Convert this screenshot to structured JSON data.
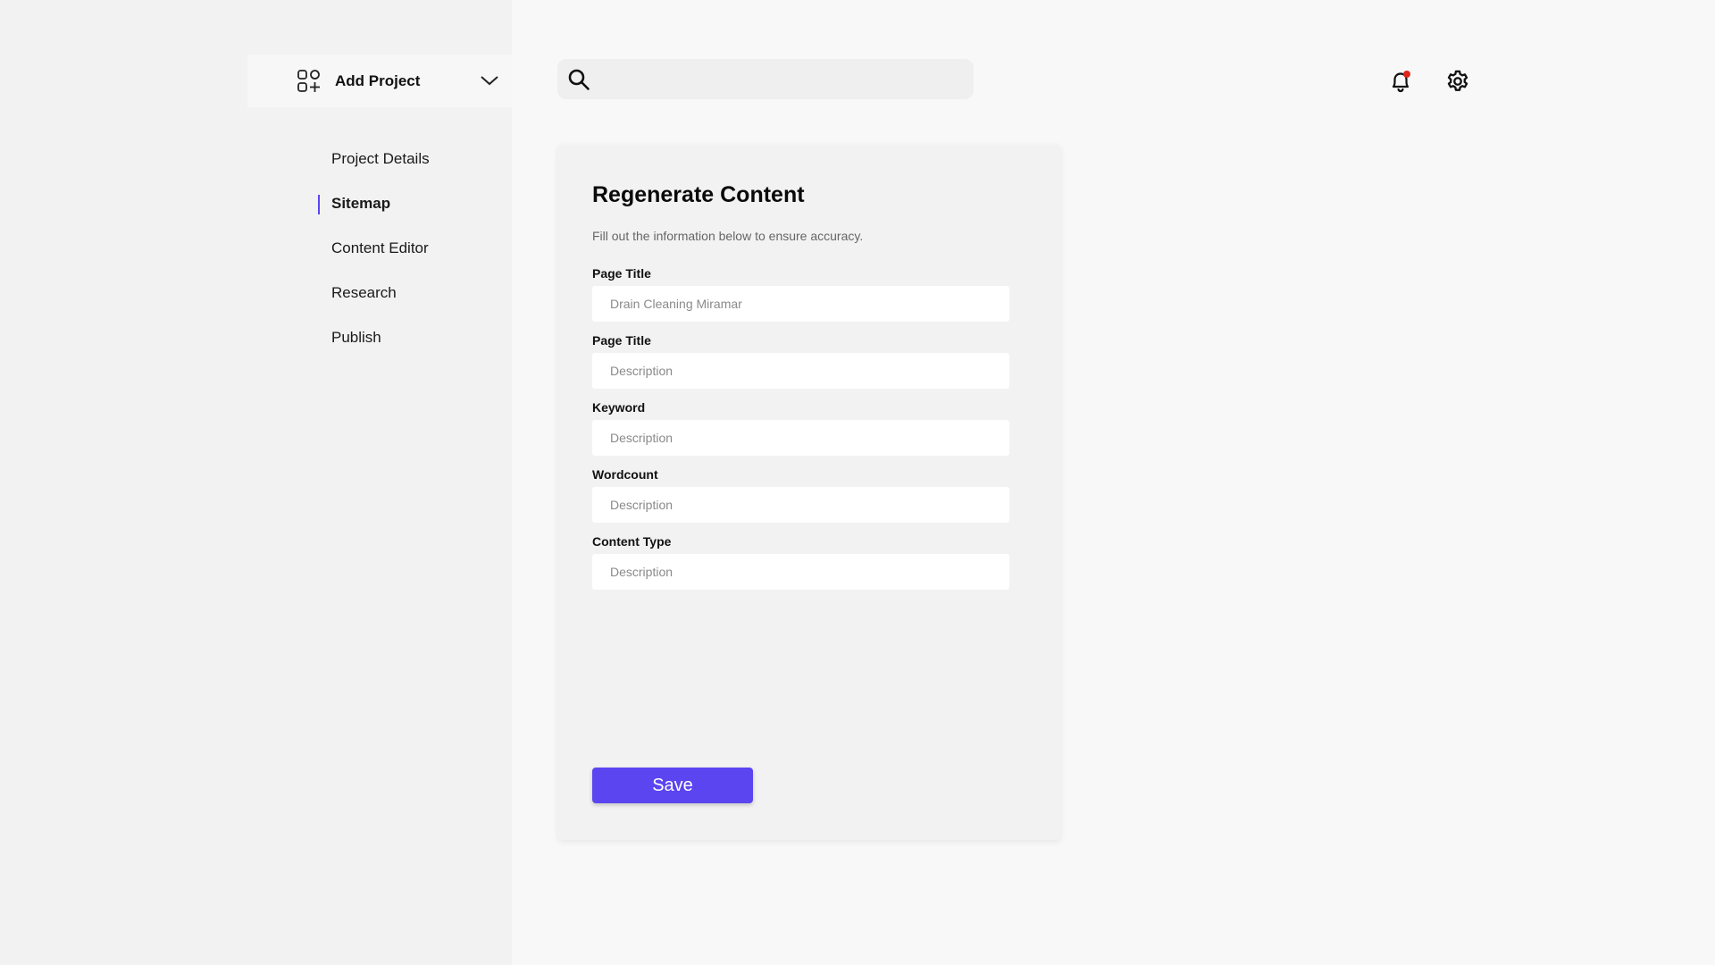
{
  "sidebar": {
    "project_selector": {
      "label": "Add Project",
      "icon": "apps-add-icon",
      "chevron": "chevron-down-icon"
    },
    "items": [
      {
        "label": "Project Details",
        "active": false
      },
      {
        "label": "Sitemap",
        "active": true
      },
      {
        "label": "Content Editor",
        "active": false
      },
      {
        "label": "Research",
        "active": false
      },
      {
        "label": "Publish",
        "active": false
      }
    ],
    "active_indicator_color": "#5b45f0"
  },
  "header": {
    "search": {
      "placeholder": "",
      "value": "",
      "icon": "search-icon"
    },
    "notifications": {
      "icon": "bell-icon",
      "has_unread": true,
      "badge_color": "#e0241b"
    },
    "settings": {
      "icon": "gear-icon"
    }
  },
  "form": {
    "title": "Regenerate Content",
    "subtitle": "Fill out the information below to ensure accuracy.",
    "fields": [
      {
        "label": "Page Title",
        "placeholder": "Drain Cleaning Miramar",
        "value": ""
      },
      {
        "label": "Page Title",
        "placeholder": "Description",
        "value": ""
      },
      {
        "label": "Keyword",
        "placeholder": "Description",
        "value": ""
      },
      {
        "label": "Wordcount",
        "placeholder": "Description",
        "value": ""
      },
      {
        "label": "Content Type",
        "placeholder": "Description",
        "value": ""
      }
    ],
    "save_label": "Save",
    "accent_color": "#5b45f0"
  }
}
